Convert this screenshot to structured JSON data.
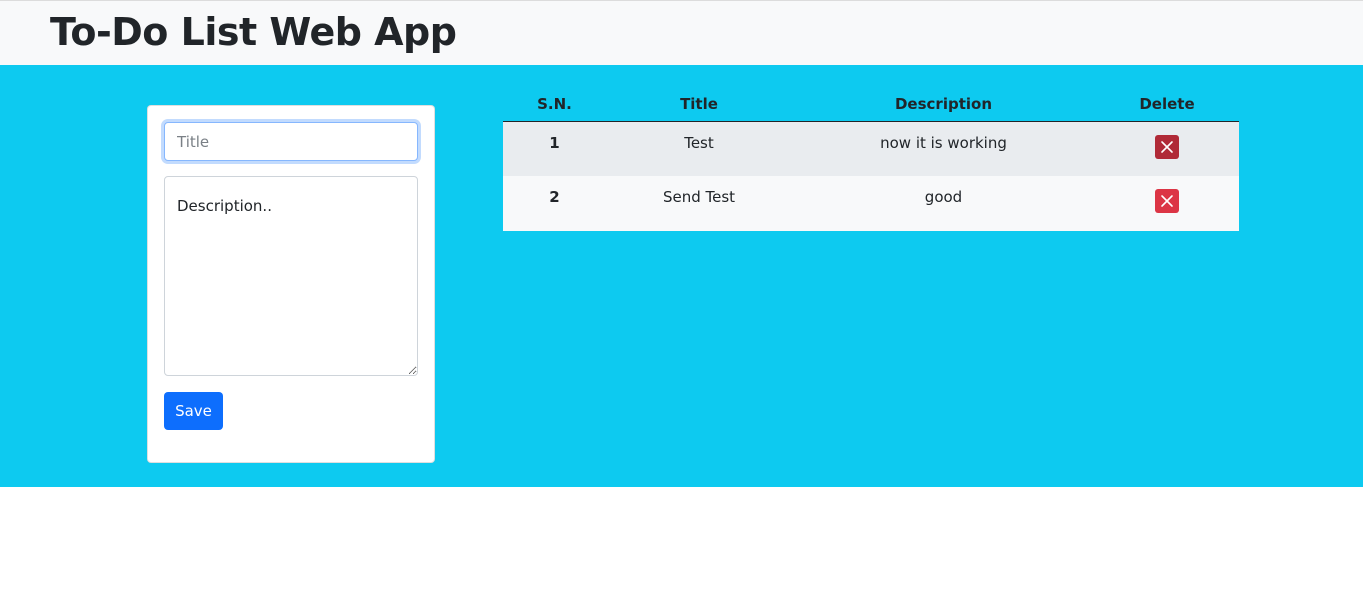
{
  "app": {
    "title": "To-Do List Web App"
  },
  "form": {
    "title_placeholder": "Title",
    "description_placeholder": "Description..",
    "save_label": "Save"
  },
  "table": {
    "headers": [
      "S.N.",
      "Title",
      "Description",
      "Delete"
    ],
    "rows": [
      {
        "sn": "1",
        "title": "Test",
        "description": "now it is working"
      },
      {
        "sn": "2",
        "title": "Send Test",
        "description": "good"
      }
    ]
  },
  "colors": {
    "navbar": "#f8f9fa",
    "main_background": "#0dcaf0",
    "save_button": "#0d6efd",
    "delete_button_active": "#b02a37",
    "delete_button": "#dc3545"
  },
  "icons": {
    "delete": "close-icon"
  }
}
